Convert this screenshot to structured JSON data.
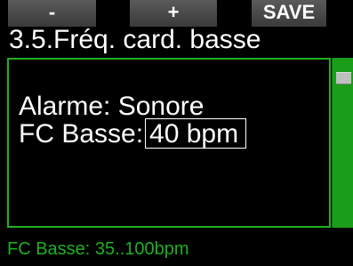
{
  "softkeys": {
    "minus": "-",
    "plus": "+",
    "save": "SAVE"
  },
  "title": "3.5.Fréq. card. basse",
  "settings": {
    "alarm_label": "Alarme:",
    "alarm_value": "Sonore",
    "fc_label": "FC Basse:",
    "fc_value": "40 bpm"
  },
  "status": "FC Basse: 35..100bpm",
  "colors": {
    "accent": "#1fb01f",
    "scrollbar": "#1a9e1a",
    "softkey": "#4a4a4a"
  }
}
